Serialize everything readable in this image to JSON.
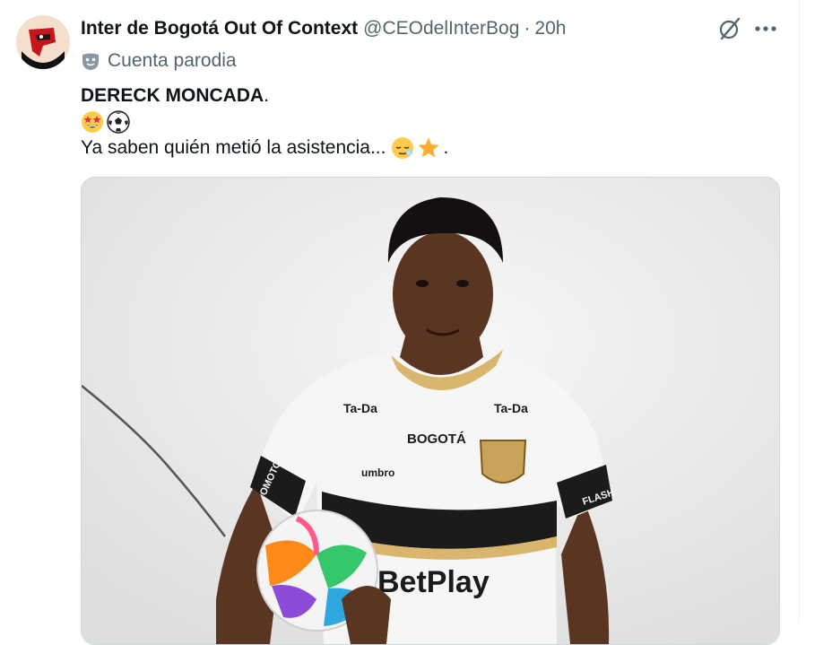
{
  "tweet": {
    "display_name": "Inter de Bogotá Out Of Context",
    "handle": "@CEOdelInterBog",
    "separator": "·",
    "time": "20h",
    "parody_label": "Cuenta parodia",
    "text_bold": "DERECK MONCADA",
    "text_bold_suffix": ".",
    "text_line3": "Ya saben quién metió la asistencia...",
    "text_line3_suffix": ".",
    "emojis": [
      "star-struck-emoji",
      "soccer-ball-emoji",
      "relieved-face-emoji",
      "star-emoji"
    ]
  },
  "media": {
    "jersey_sponsor_left": "Ta-Da",
    "jersey_sponsor_right": "Ta-Da",
    "jersey_brand": "umbro",
    "jersey_chest": "BOGOTÁ",
    "jersey_main_sponsor": "BetPlay",
    "jersey_sleeve_left": "OMOTORE",
    "jersey_sleeve_right": "FLASH",
    "colors": {
      "shirt": "#f6f6f4",
      "band": "#1b1b1b",
      "trim": "#d9b56e",
      "skin": "#5a3522"
    }
  },
  "icons": {
    "grok": "grok-icon",
    "more": "more-horizontal-icon",
    "parody": "parody-mask-icon"
  }
}
